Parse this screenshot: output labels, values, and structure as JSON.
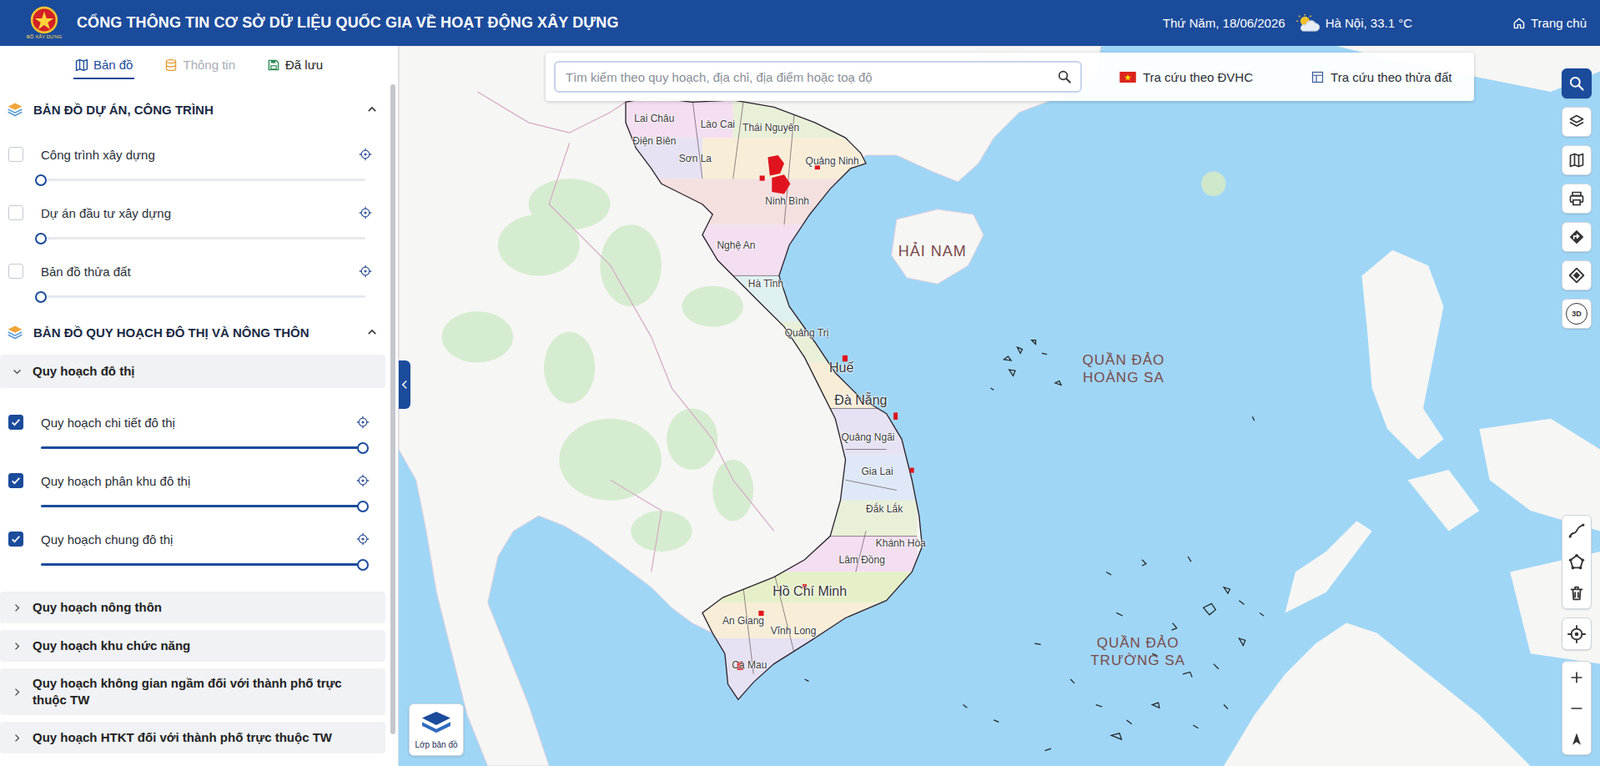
{
  "header": {
    "logo_caption": "BỘ XÂY DỰNG",
    "title": "CỔNG THÔNG TIN CƠ SỞ DỮ LIỆU QUỐC GIA VỀ HOẠT ĐỘNG XÂY DỰNG",
    "date": "Thứ Năm, 18/06/2026",
    "weather": "Hà Nội, 33.1 °C",
    "home": "Trang chủ"
  },
  "tabs": [
    {
      "label": "Bản đồ",
      "selected": true,
      "disabled": false
    },
    {
      "label": "Thông tin",
      "selected": false,
      "disabled": true
    },
    {
      "label": "Đã lưu",
      "selected": false,
      "disabled": false
    }
  ],
  "sections": [
    {
      "title": "BẢN ĐỒ DỰ ÁN, CÔNG TRÌNH",
      "kind": "layers",
      "expanded": true,
      "items": [
        {
          "label": "Công trình xây dựng",
          "checked": false,
          "level": 0
        },
        {
          "label": "Dự án đầu tư xây dựng",
          "checked": false,
          "level": 0
        },
        {
          "label": "Bản đồ thửa đất",
          "checked": false,
          "level": 0
        }
      ]
    },
    {
      "title": "BẢN ĐỒ QUY HOẠCH ĐÔ THỊ VÀ NÔNG THÔN",
      "kind": "groups",
      "expanded": true,
      "items": [
        {
          "label": "Quy hoạch đô thị",
          "expanded": true,
          "items": [
            {
              "label": "Quy hoạch chi tiết đô thị",
              "checked": true,
              "level": 1
            },
            {
              "label": "Quy hoạch phân khu đô thị",
              "checked": true,
              "level": 1
            },
            {
              "label": "Quy hoạch chung đô thị",
              "checked": true,
              "level": 1
            }
          ]
        },
        {
          "label": "Quy hoạch nông thôn",
          "expanded": false,
          "items": []
        },
        {
          "label": "Quy hoạch khu chức năng",
          "expanded": false,
          "items": []
        },
        {
          "label": "Quy hoạch không gian ngầm đối với thành phố trực thuộc TW",
          "expanded": false,
          "items": []
        },
        {
          "label": "Quy hoạch HTKT đối với thành phố trực thuộc TW",
          "expanded": false,
          "items": []
        }
      ]
    }
  ],
  "search": {
    "placeholder": "Tìm kiếm theo quy hoạch, địa chỉ, địa điểm hoặc toạ độ"
  },
  "lookup_buttons": [
    {
      "label": "Tra cứu theo ĐVHC"
    },
    {
      "label": "Tra cứu theo thửa đất"
    }
  ],
  "map_tools": [
    {
      "selected": true
    },
    {
      "selected": false
    },
    {
      "selected": false
    },
    {
      "selected": false
    },
    {
      "selected": false
    },
    {
      "selected": false
    },
    {
      "selected": false,
      "label": "3D"
    }
  ],
  "layer_button": {
    "label": "Lớp bản đồ"
  },
  "map_labels": [
    {
      "text": "Lai Châu",
      "kind": "province"
    },
    {
      "text": "Lào Cai",
      "kind": "province"
    },
    {
      "text": "Thái Nguyên",
      "kind": "province"
    },
    {
      "text": "Điện Biên",
      "kind": "province"
    },
    {
      "text": "Sơn La",
      "kind": "province"
    },
    {
      "text": "Quảng Ninh",
      "kind": "province"
    },
    {
      "text": "Ninh Bình",
      "kind": "province"
    },
    {
      "text": "Nghệ An",
      "kind": "province"
    },
    {
      "text": "Hà Tĩnh",
      "kind": "province"
    },
    {
      "text": "Quảng Trị",
      "kind": "province"
    },
    {
      "text": "Huế",
      "kind": "city"
    },
    {
      "text": "Đà Nẵng",
      "kind": "city"
    },
    {
      "text": "Quảng Ngãi",
      "kind": "province"
    },
    {
      "text": "Gia Lai",
      "kind": "province"
    },
    {
      "text": "Đắk Lắk",
      "kind": "province"
    },
    {
      "text": "Khánh Hòa",
      "kind": "province"
    },
    {
      "text": "Lâm Đồng",
      "kind": "province"
    },
    {
      "text": "Hồ Chí Minh",
      "kind": "city"
    },
    {
      "text": "An Giang",
      "kind": "province"
    },
    {
      "text": "Vĩnh Long",
      "kind": "province"
    },
    {
      "text": "Cà Mau",
      "kind": "province"
    },
    {
      "text": "HẢI NAM",
      "kind": "region"
    },
    {
      "text": "QUẦN ĐẢO HOÀNG SA",
      "kind": "archipelago"
    },
    {
      "text": "QUẦN ĐẢO TRƯỜNG SA",
      "kind": "archipelago"
    }
  ]
}
